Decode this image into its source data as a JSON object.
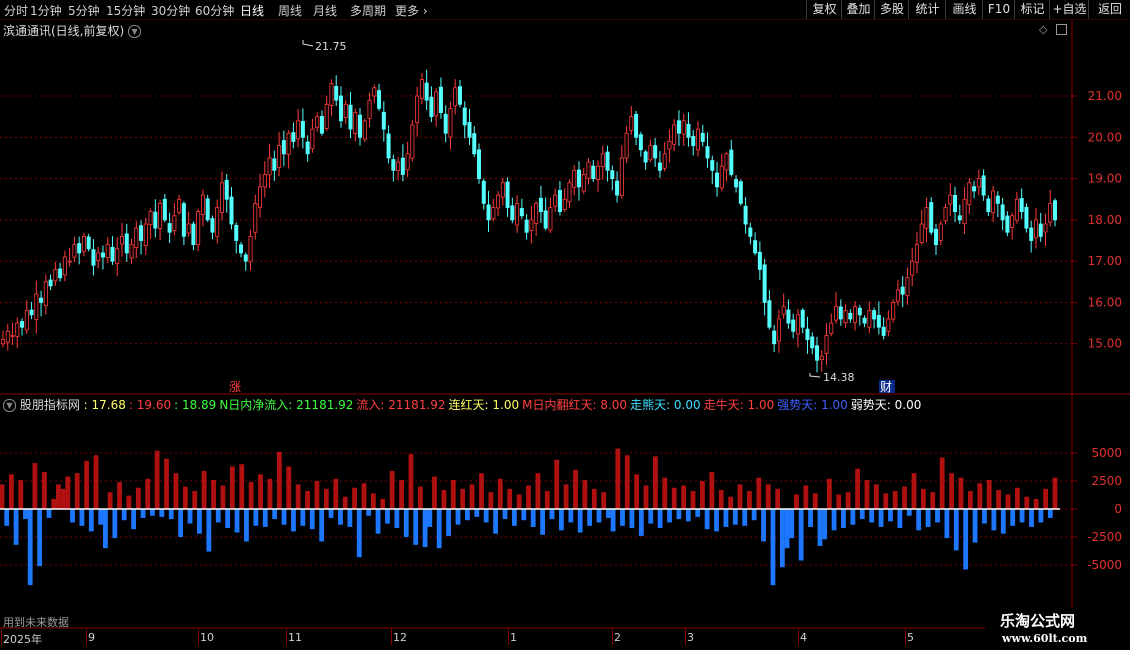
{
  "toolbar": {
    "periods": [
      "分时",
      "1分钟",
      "5分钟",
      "15分钟",
      "30分钟",
      "60分钟",
      "日线",
      "周线",
      "月线",
      "多周期",
      "更多"
    ],
    "active": "日线",
    "right_buttons": [
      "复权",
      "叠加",
      "多股",
      "统计",
      "画线",
      "F10",
      "标记",
      "+自选",
      "返回"
    ]
  },
  "main": {
    "title": "滨通通讯(日线,前复权)",
    "high_label": "21.75",
    "low_label": "14.38",
    "badge_zhang": "涨",
    "badge_cai": "财",
    "y_ticks": [
      "21.00",
      "20.00",
      "19.00",
      "18.00",
      "17.00",
      "16.00",
      "15.00"
    ]
  },
  "indicator": {
    "name": "股朋指标网",
    "values": [
      {
        "label": "",
        "value": ": 17.68",
        "color": "#ffff66"
      },
      {
        "label": "",
        "value": ": 19.60",
        "color": "#ff4040"
      },
      {
        "label": "",
        "value": ": 18.89",
        "color": "#40ff40"
      },
      {
        "label": "N日内净流入",
        "value": ": 21181.92",
        "color": "#40ff40"
      },
      {
        "label": "流入",
        "value": ": 21181.92",
        "color": "#ff4040"
      },
      {
        "label": "连红天",
        "value": ": 1.00",
        "color": "#ffff66"
      },
      {
        "label": "M日内翻红天",
        "value": ": 8.00",
        "color": "#ff4040"
      },
      {
        "label": "走熊天",
        "value": ": 0.00",
        "color": "#40e0ff"
      },
      {
        "label": "走牛天",
        "value": ": 1.00",
        "color": "#ff4040"
      },
      {
        "label": "强势天",
        "value": ": 1.00",
        "color": "#4060ff"
      },
      {
        "label": "弱势天",
        "value": ": 0.00",
        "color": "#ffffff"
      }
    ],
    "y_ticks": [
      "5000",
      "2500",
      "0",
      "-2500",
      "-5000"
    ],
    "note": "用到未来数据"
  },
  "x_axis": {
    "labels": [
      "2025年",
      "9",
      "10",
      "11",
      "12",
      "1",
      "2",
      "3",
      "4",
      "5"
    ]
  },
  "watermark": {
    "line1": "乐淘公式网",
    "line2": "www.60lt.com"
  },
  "chart_data": {
    "type": "candlestick",
    "price_ylim": [
      14.0,
      22.6
    ],
    "flow_ylim": [
      -8000,
      8000
    ],
    "colors": {
      "up": "#ff3c3c",
      "down": "#54ffff",
      "flow_pos": "#b01010",
      "flow_neg": "#1e78ff"
    },
    "closes": [
      15.1,
      15.3,
      15.2,
      15.5,
      15.4,
      15.8,
      15.7,
      16.2,
      16.0,
      16.5,
      16.4,
      16.8,
      16.6,
      17.1,
      17.0,
      17.4,
      17.2,
      17.6,
      17.3,
      16.9,
      17.2,
      17.1,
      17.4,
      17.0,
      17.3,
      17.6,
      17.2,
      17.4,
      17.8,
      17.5,
      17.9,
      18.2,
      17.8,
      18.4,
      18.0,
      17.7,
      18.1,
      18.5,
      17.6,
      17.9,
      17.4,
      18.2,
      18.6,
      18.0,
      17.7,
      18.3,
      18.9,
      18.5,
      17.9,
      17.5,
      17.2,
      17.0,
      17.6,
      18.4,
      18.8,
      19.1,
      19.5,
      19.2,
      19.8,
      19.6,
      20.1,
      19.9,
      20.4,
      20.0,
      19.6,
      20.2,
      20.5,
      20.1,
      20.8,
      21.3,
      20.9,
      20.4,
      20.8,
      20.2,
      20.6,
      20.0,
      20.4,
      20.9,
      21.2,
      20.7,
      20.2,
      19.5,
      19.2,
      19.4,
      19.1,
      19.6,
      20.3,
      21.0,
      21.4,
      20.9,
      20.5,
      21.1,
      20.6,
      20.1,
      20.7,
      21.2,
      20.8,
      20.3,
      20.0,
      19.6,
      19.0,
      18.4,
      18.0,
      18.3,
      18.6,
      18.9,
      18.3,
      18.0,
      18.4,
      18.1,
      17.7,
      18.0,
      18.4,
      18.2,
      17.8,
      18.3,
      18.6,
      18.2,
      18.5,
      18.9,
      19.2,
      18.8,
      19.1,
      19.4,
      19.0,
      19.3,
      19.6,
      19.2,
      19.0,
      18.6,
      19.5,
      20.1,
      20.5,
      20.0,
      19.7,
      19.4,
      19.8,
      19.5,
      19.2,
      19.6,
      19.9,
      20.3,
      20.1,
      20.4,
      20.0,
      19.8,
      20.2,
      19.9,
      19.5,
      19.2,
      18.8,
      19.3,
      19.6,
      19.1,
      18.8,
      18.4,
      17.9,
      17.6,
      17.2,
      16.8,
      16.0,
      15.4,
      15.0,
      15.6,
      15.9,
      15.5,
      15.3,
      15.7,
      15.4,
      15.1,
      14.9,
      14.6,
      14.7,
      15.2,
      15.5,
      15.9,
      15.6,
      15.8,
      15.6,
      15.9,
      15.7,
      15.5,
      15.8,
      15.6,
      15.4,
      15.2,
      15.6,
      16.0,
      16.3,
      16.2,
      16.6,
      17.0,
      17.4,
      17.9,
      18.3,
      17.7,
      17.4,
      17.9,
      18.3,
      18.6,
      18.2,
      18.0,
      18.5,
      18.9,
      18.7,
      19.0,
      18.6,
      18.2,
      18.7,
      18.4,
      18.0,
      17.7,
      18.1,
      18.5,
      18.2,
      17.8,
      17.5,
      18.0,
      17.6,
      17.9,
      18.4,
      18.0
    ],
    "flows": [
      2200,
      -1500,
      3100,
      -3200,
      2600,
      -900,
      -6800,
      4100,
      -5100,
      3300,
      -800,
      900,
      2200,
      1800,
      2900,
      -1200,
      3200,
      -1500,
      4300,
      -2000,
      4800,
      -1400,
      -3500,
      1500,
      -2600,
      2400,
      -1000,
      1200,
      -1800,
      1900,
      -800,
      2700,
      -600,
      5200,
      -700,
      4500,
      -900,
      3200,
      -2500,
      2000,
      -1300,
      1600,
      -2200,
      3400,
      -3800,
      2600,
      -1200,
      2100,
      -1700,
      3800,
      -2100,
      4000,
      -2900,
      2400,
      -1500,
      3100,
      -1600,
      2700,
      -900,
      5100,
      -1400,
      3800,
      -2000,
      2200,
      -1500,
      1600,
      -1800,
      2500,
      -2900,
      1800,
      -800,
      2700,
      -1400,
      1100,
      -1600,
      1900,
      -4300,
      2300,
      -600,
      1400,
      -2200,
      900,
      -1300,
      3400,
      -1700,
      2600,
      -2500,
      4900,
      -3200,
      2000,
      -3400,
      -1600,
      2900,
      -3500,
      1700,
      -2400,
      2600,
      -1400,
      1800,
      -1000,
      2200,
      -700,
      3200,
      -1200,
      1500,
      -2200,
      2700,
      -900,
      1800,
      -1500,
      1300,
      -1000,
      2100,
      -1600,
      3200,
      -2300,
      1600,
      -900,
      4400,
      -1900,
      2200,
      -1200,
      3500,
      -2100,
      2600,
      -1500,
      1800,
      -1200,
      1500,
      -800,
      -2000,
      5400,
      -1500,
      4800,
      -1700,
      3100,
      -2400,
      2100,
      -1300,
      4700,
      -1700,
      2800,
      -1200,
      1900,
      -900,
      2100,
      -1100,
      1600,
      -700,
      2500,
      -1800,
      3300,
      -2000,
      1700,
      -1600,
      1100,
      -1400,
      2200,
      -1500,
      1600,
      -1000,
      2800,
      -2900,
      2200,
      -6800,
      1800,
      -5200,
      -3500,
      -2600,
      1300,
      -4600,
      2100,
      -1600,
      1400,
      -3300,
      -2700,
      2700,
      -1900,
      1300,
      -1700,
      1500,
      -1400,
      3600,
      -900,
      2600,
      -1200,
      2200,
      -1600,
      1400,
      -1100,
      1600,
      -1700,
      2000,
      -600,
      3200,
      -1900,
      1800,
      -1600,
      1500,
      -1200,
      4600,
      -2600,
      3200,
      -3700,
      2800,
      -5400,
      1600,
      -3000,
      2300,
      -1300,
      2600,
      -1900,
      1700,
      -2200,
      1300,
      -1500,
      1900,
      -1200,
      1100,
      -1600,
      900,
      -1200,
      1800,
      -800,
      2800
    ]
  }
}
